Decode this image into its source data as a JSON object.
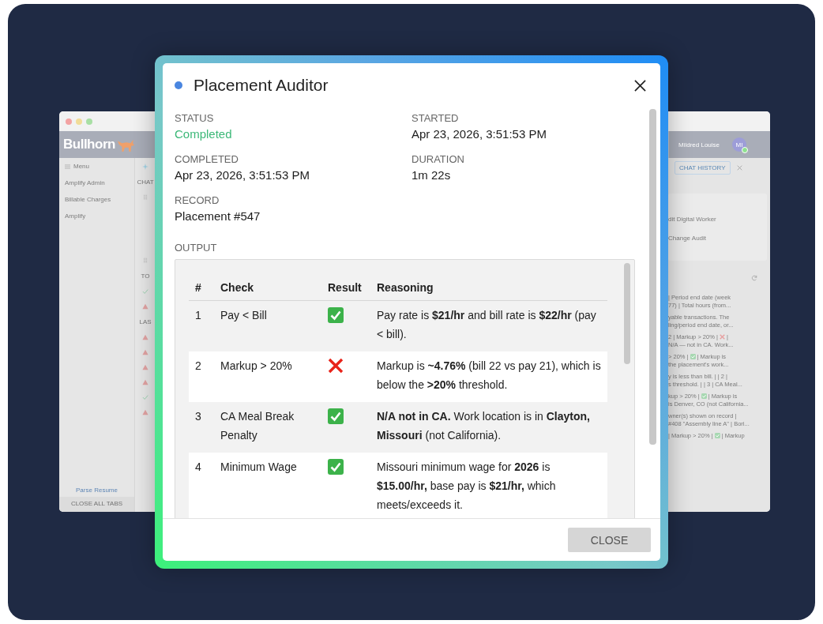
{
  "backdrop_app": {
    "logo": "Bullhorn",
    "menu_label": "Menu",
    "sidebar_items": [
      "Amplify Admin",
      "Billable Charges",
      "Amplify"
    ],
    "parse_resume": "Parse Resume",
    "close_all_tabs": "CLOSE ALL TABS",
    "strip_items": [
      {
        "kind": "sparkle"
      },
      {
        "kind": "label",
        "text": "CHAT"
      },
      {
        "kind": "grip"
      },
      {
        "kind": "gap"
      },
      {
        "kind": "grip"
      },
      {
        "kind": "label",
        "text": "TO"
      },
      {
        "kind": "pass"
      },
      {
        "kind": "warn"
      },
      {
        "kind": "label",
        "text": "LAS"
      },
      {
        "kind": "warn"
      },
      {
        "kind": "warn"
      },
      {
        "kind": "warn"
      },
      {
        "kind": "warn"
      },
      {
        "kind": "pass"
      },
      {
        "kind": "warn"
      }
    ],
    "user_name": "Mildred Louise",
    "avatar_initials": "MI",
    "chat_history_button": "CHAT HISTORY",
    "workers": [
      "dit Digital Worker",
      "Change Audit"
    ],
    "activity": [
      {
        "lines": [
          [
            {
              "kind": "text",
              "text": "| Period end date (week"
            }
          ],
          [
            {
              "kind": "text",
              "text": "77) | Total hours (from..."
            }
          ]
        ]
      },
      {
        "lines": [
          [
            {
              "kind": "text",
              "text": "yable transactions. The"
            }
          ],
          [
            {
              "kind": "text",
              "text": "ling/period end date, or..."
            }
          ]
        ]
      },
      {
        "lines": [
          [
            {
              "kind": "text",
              "text": "2 | Markup > 20% |"
            },
            {
              "kind": "fail"
            },
            {
              "kind": "text",
              "text": "|"
            }
          ],
          [
            {
              "kind": "text",
              "text": "N/A — not in CA. Work..."
            }
          ]
        ]
      },
      {
        "lines": [
          [
            {
              "kind": "text",
              "text": "> 20% |"
            },
            {
              "kind": "pass"
            },
            {
              "kind": "text",
              "text": "| Markup is"
            }
          ],
          [
            {
              "kind": "text",
              "text": "the placement's work..."
            }
          ]
        ]
      },
      {
        "lines": [
          [
            {
              "kind": "text",
              "text": "y is less than bill. | | 2 |"
            }
          ],
          [
            {
              "kind": "text",
              "text": "s threshold. | | 3 | CA Meal..."
            }
          ]
        ]
      },
      {
        "lines": [
          [
            {
              "kind": "text",
              "text": "kup > 20% |"
            },
            {
              "kind": "pass"
            },
            {
              "kind": "text",
              "text": "| Markup is"
            }
          ],
          [
            {
              "kind": "text",
              "text": "is Denver, CO (not California..."
            }
          ]
        ]
      },
      {
        "lines": [
          [
            {
              "kind": "text",
              "text": "wner(s) shown on record |"
            }
          ],
          [
            {
              "kind": "text",
              "text": "#408 \"Assembly line A\" | Bori..."
            }
          ]
        ]
      },
      {
        "lines": [
          [
            {
              "kind": "text",
              "text": "| Markup > 20% |"
            },
            {
              "kind": "pass"
            },
            {
              "kind": "text",
              "text": "| Markup"
            }
          ]
        ]
      }
    ]
  },
  "modal": {
    "title": "Placement Auditor",
    "fields": [
      {
        "label": "STATUS",
        "value": "Completed",
        "success": true
      },
      {
        "label": "STARTED",
        "value": "Apr 23, 2026, 3:51:53 PM",
        "success": false
      },
      {
        "label": "COMPLETED",
        "value": "Apr 23, 2026, 3:51:53 PM",
        "success": false
      },
      {
        "label": "DURATION",
        "value": "1m 22s",
        "success": false
      },
      {
        "label": "RECORD",
        "value": "Placement #547",
        "success": false
      }
    ],
    "output_label": "OUTPUT",
    "table": {
      "columns": [
        "#",
        "Check",
        "Result",
        "Reasoning"
      ],
      "rows": [
        {
          "number": "1",
          "check": "Pay < Bill",
          "passed": true,
          "reasoning": "Pay rate is **$21/hr** and bill rate is **$22/hr** (pay < bill)."
        },
        {
          "number": "2",
          "check": "Markup > 20%",
          "passed": false,
          "reasoning": "Markup is **~4.76%** (bill 22 vs pay 21), which is below the **>20%** threshold."
        },
        {
          "number": "3",
          "check": "CA Meal Break Penalty",
          "passed": true,
          "reasoning": "**N/A not in CA.** Work location is in **Clayton, Missouri** (not California)."
        },
        {
          "number": "4",
          "check": "Minimum Wage",
          "passed": true,
          "reasoning": "Missouri minimum wage for **2026** is **$15.00/hr,** base pay is **$21/hr,** which meets/exceeds it."
        }
      ]
    },
    "close_button": "CLOSE"
  }
}
